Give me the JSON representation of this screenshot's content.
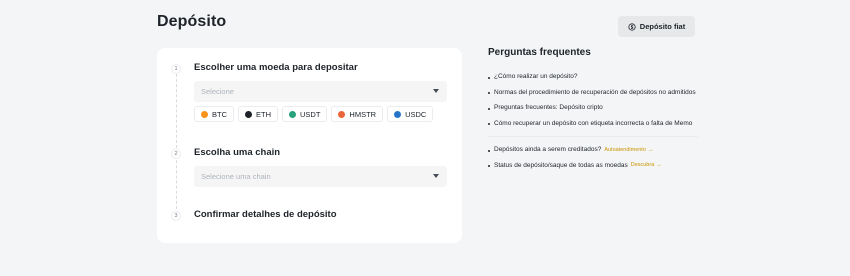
{
  "page": {
    "title": "Depósito"
  },
  "header": {
    "fiat_button_label": "Depósito fiat"
  },
  "steps": [
    {
      "number": "1",
      "title": "Escolher uma moeda para depositar",
      "select_placeholder": "Selecione"
    },
    {
      "number": "2",
      "title": "Escolha uma chain",
      "select_placeholder": "Selecione uma chain"
    },
    {
      "number": "3",
      "title": "Confirmar detalhes de depósito"
    }
  ],
  "coins": [
    {
      "symbol": "BTC",
      "color": "#f7931a"
    },
    {
      "symbol": "ETH",
      "color": "#1e2329"
    },
    {
      "symbol": "USDT",
      "color": "#26a17b"
    },
    {
      "symbol": "HMSTR",
      "color": "#e8663a"
    },
    {
      "symbol": "USDC",
      "color": "#2775ca"
    }
  ],
  "faq": {
    "title": "Perguntas frequentes",
    "items": [
      "¿Cómo realizar un depósito?",
      "Normas del procedimiento de recuperación de depósitos no admitidos",
      "Preguntas frecuentes: Depósito cripto",
      "Cómo recuperar un depósito con etiqueta incorrecta o falta de Memo"
    ],
    "extra": [
      {
        "text": "Depósitos ainda a serem creditados?",
        "link": "Autoatendimento"
      },
      {
        "text": "Status de depósito/saque de todas as moedas",
        "link": "Descubra"
      }
    ]
  },
  "colors": {
    "accent": "#c99400",
    "background": "#f4f5f7",
    "card": "#ffffff"
  }
}
